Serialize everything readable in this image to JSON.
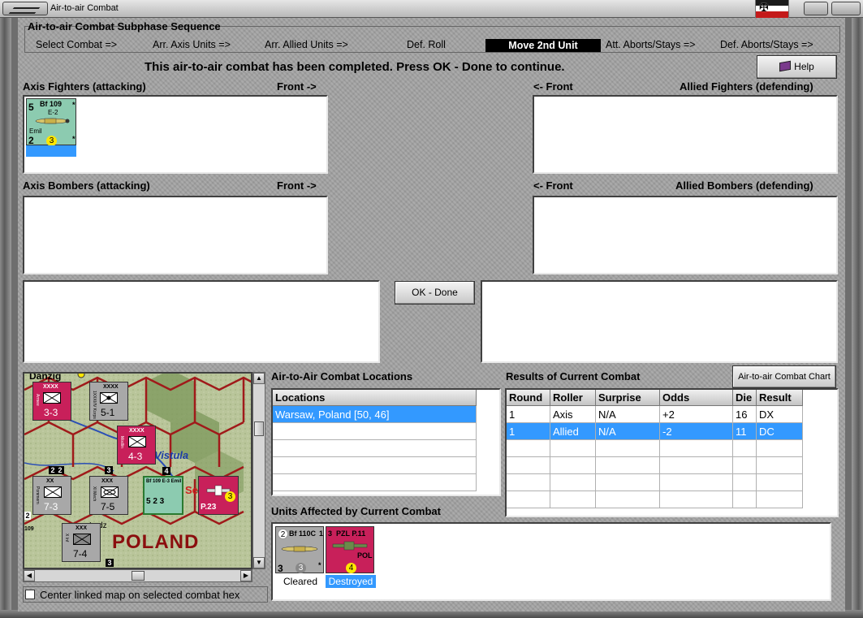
{
  "window": {
    "title": "Air-to-air Combat"
  },
  "subphase": {
    "title": "Air-to-air Combat Subphase Sequence",
    "steps": [
      "Select Combat =>",
      "Arr. Axis Units =>",
      "Arr. Allied Units =>",
      "Def. Roll",
      "Move 2nd Unit",
      "Att. Aborts/Stays =>",
      "Def. Aborts/Stays =>"
    ],
    "active_step": "Move 2nd Unit"
  },
  "message": "This air-to-air combat has been completed.  Press OK - Done to continue.",
  "buttons": {
    "help": "Help",
    "ok_done": "OK - Done",
    "chart": "Air-to-air Combat Chart"
  },
  "sections": {
    "axis_fighters": "Axis Fighters (attacking)",
    "allied_fighters": "Allied Fighters (defending)",
    "axis_bombers": "Axis Bombers (attacking)",
    "allied_bombers": "Allied Bombers (defending)",
    "front_right": "Front ->",
    "front_left": "<- Front"
  },
  "axis_fighter_unit": {
    "name": "Bf 109",
    "variant": "E-2",
    "subname": "Emil",
    "top_left": "5",
    "bottom_left": "2",
    "dot": "3",
    "star_top": "*",
    "star_bottom": "*"
  },
  "map": {
    "city_top": "Danzig",
    "river": "Vistula",
    "country": "POLAND",
    "city_bottom": "Lodz",
    "city_partial": "Se",
    "counters": [
      {
        "size": "XXXX",
        "name": "Armee",
        "value": "3-3",
        "corner": ""
      },
      {
        "size": "XXXX",
        "name": "1XXXI/IV Korps",
        "value": "5-1",
        "corner": ""
      },
      {
        "size": "XXXX",
        "name": "Modlin",
        "value": "4-3",
        "corner": ""
      },
      {
        "size": "XX",
        "name": "Pommern",
        "value": "7-3",
        "corner": "2"
      },
      {
        "size": "XXX",
        "name": "XI Mech",
        "value": "7-5",
        "corner": "3"
      },
      {
        "size": "XXX",
        "name": "X Inf",
        "value": "7-4",
        "corner": ""
      },
      {
        "size": "",
        "name": "Bf 109 E-3 Emil",
        "value": "5 2 3",
        "corner": "4"
      },
      {
        "size": "",
        "name": "P.23",
        "value": "3 3",
        "corner": ""
      }
    ],
    "corner_marks": [
      "2",
      "2",
      "109",
      "3"
    ]
  },
  "checkbox_label": "Center linked map on selected combat hex",
  "locations": {
    "title": "Air-to-Air Combat Locations",
    "header": "Locations",
    "items": [
      "Warsaw, Poland [50, 46]"
    ]
  },
  "results": {
    "title": "Results of Current Combat",
    "columns": [
      "Round",
      "Roller",
      "Surprise",
      "Odds",
      "Die",
      "Result"
    ],
    "rows": [
      [
        "1",
        "Axis",
        "N/A",
        "+2",
        "16",
        "DX"
      ],
      [
        "1",
        "Allied",
        "N/A",
        "-2",
        "11",
        "DC"
      ]
    ]
  },
  "affected": {
    "title": "Units Affected by Current Combat",
    "units": [
      {
        "name": "Bf 110C",
        "top_left": "2",
        "top_right": "1",
        "bottom_left": "3",
        "dot": "3",
        "star": "*",
        "status": "Cleared"
      },
      {
        "name": "PZL P.11",
        "top_left": "3",
        "nation": "POL",
        "dot": "4",
        "status": "Destroyed"
      }
    ]
  },
  "colors": {
    "selection": "#3399ff",
    "polish_counter": "#c8205a",
    "german_counter": "#a8a8a8",
    "active_step_bg": "#000000",
    "german_air": "#8ccbb0"
  }
}
